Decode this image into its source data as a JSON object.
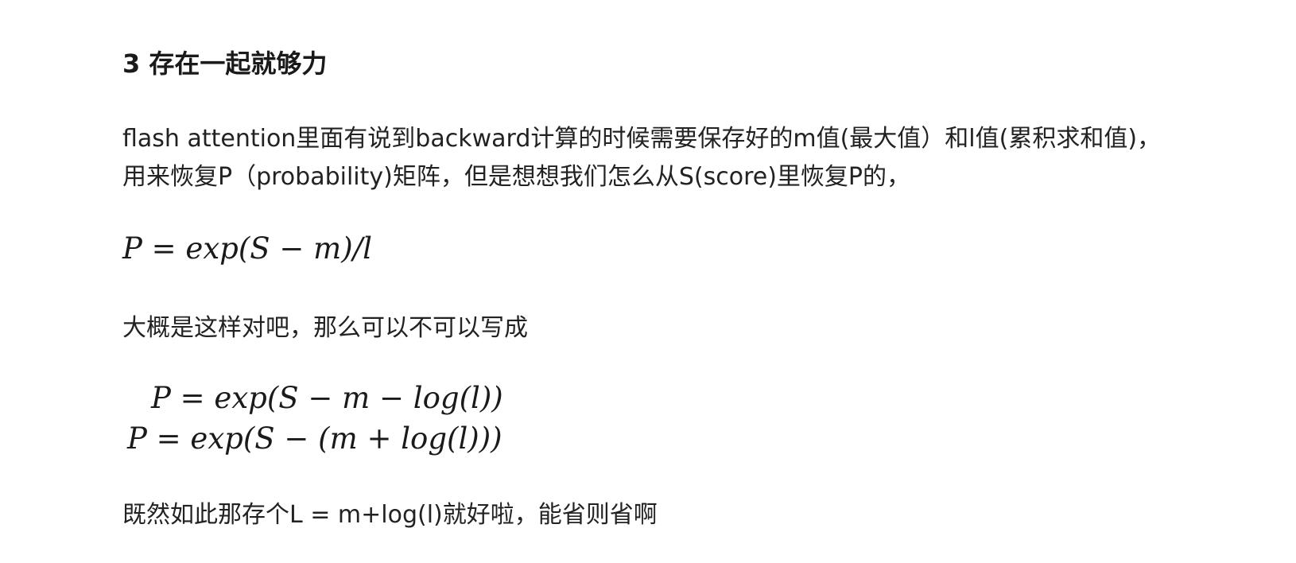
{
  "heading": "3 存在一起就够力",
  "paragraph1": {
    "line1": "flash attention里面有说到backward计算的时候需要保存好的m值(最大值）和l值(累积求和值)，",
    "line2": "用来恢复P（probability)矩阵，但是想想我们怎么从S(score)里恢复P的，"
  },
  "formula1": "P = exp(S − m)/l",
  "paragraph2": "大概是这样对吧，那么可以不可以写成",
  "formula2": "P = exp(S − m − log(l))",
  "formula3": "P = exp(S − (m + log(l)))",
  "paragraph3": "既然如此那存个L = m+log(l)就好啦，能省则省啊"
}
